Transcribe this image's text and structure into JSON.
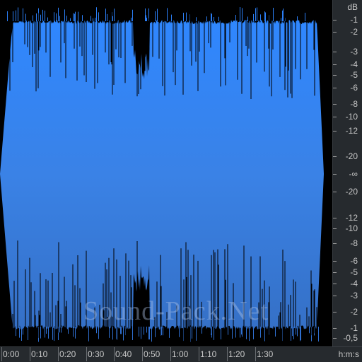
{
  "waveform": {
    "fill_color_top": "#2f87ff",
    "fill_color_bottom": "#3572c8",
    "line_color": "#2b7ef5",
    "background": "#000000"
  },
  "db_scale": {
    "unit": "dB",
    "labels": [
      "-1",
      "-2",
      "-3",
      "-4",
      "-5",
      "-6",
      "-8",
      "-10",
      "-12",
      "-20",
      "-∞",
      "-20",
      "-12",
      "-10",
      "-8",
      "-6",
      "-5",
      "-4",
      "-3",
      "-2",
      "-1",
      "-0,5"
    ]
  },
  "time_ruler": {
    "labels": [
      "0:00",
      "0:10",
      "0:20",
      "0:30",
      "0:40",
      "0:50",
      "1:00",
      "1:10",
      "1:20",
      "1:30"
    ],
    "unit": "h:m:s"
  },
  "watermark": "Sound-Pack.Net"
}
